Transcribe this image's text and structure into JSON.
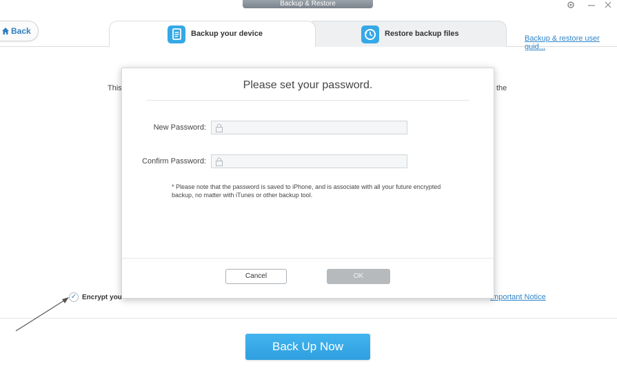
{
  "window": {
    "title": "Backup & Restore"
  },
  "nav": {
    "back_label": "Back",
    "tabs": [
      {
        "label": "Backup your device",
        "active": true
      },
      {
        "label": "Restore backup files",
        "active": false
      }
    ],
    "guide_link": "Backup & restore user guid..."
  },
  "background": {
    "text_left": "This",
    "text_right": "the",
    "encrypt_label": "Encrypt you",
    "notice_link": "Important Notice",
    "primary_button": "Back Up Now"
  },
  "dialog": {
    "title": "Please set your password.",
    "fields": [
      {
        "label": "New Password:",
        "value": ""
      },
      {
        "label": "Confirm Password:",
        "value": ""
      }
    ],
    "note": "* Please note that the password is saved to iPhone, and is associate with all your future encrypted backup, no matter with iTunes or other backup tool.",
    "cancel_label": "Cancel",
    "ok_label": "OK"
  },
  "colors": {
    "accent": "#35a8e6",
    "link": "#2f84c8",
    "button_primary": "#3aaae8",
    "button_disabled": "#b6babd"
  }
}
